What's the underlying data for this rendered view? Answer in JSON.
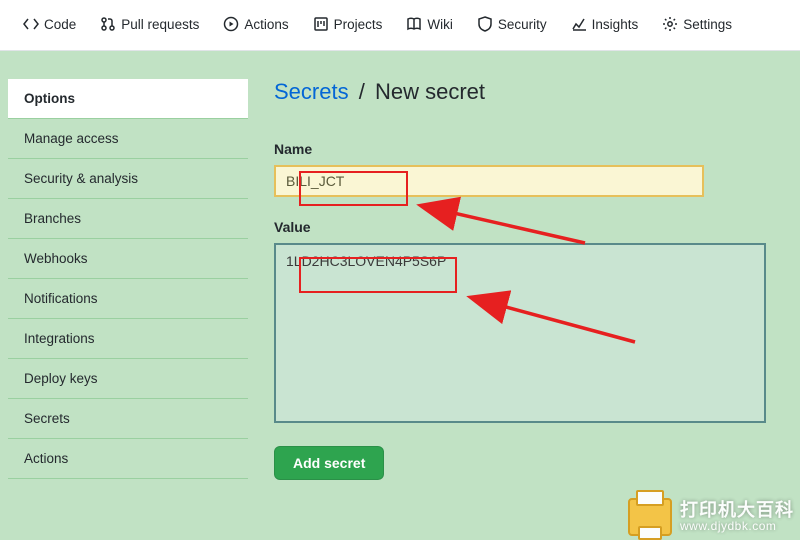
{
  "topnav": {
    "items": [
      {
        "label": "Code"
      },
      {
        "label": "Pull requests"
      },
      {
        "label": "Actions"
      },
      {
        "label": "Projects"
      },
      {
        "label": "Wiki"
      },
      {
        "label": "Security"
      },
      {
        "label": "Insights"
      },
      {
        "label": "Settings"
      }
    ]
  },
  "sidebar": {
    "items": [
      {
        "label": "Options",
        "active": true
      },
      {
        "label": "Manage access"
      },
      {
        "label": "Security & analysis"
      },
      {
        "label": "Branches"
      },
      {
        "label": "Webhooks"
      },
      {
        "label": "Notifications"
      },
      {
        "label": "Integrations"
      },
      {
        "label": "Deploy keys"
      },
      {
        "label": "Secrets"
      },
      {
        "label": "Actions"
      }
    ]
  },
  "breadcrumb": {
    "link": "Secrets",
    "sep": "/",
    "current": "New secret"
  },
  "form": {
    "name_label": "Name",
    "name_value": "BILI_JCT",
    "value_label": "Value",
    "value_value": "1LD2HC3LOVEN4P5S6P",
    "submit_label": "Add secret"
  },
  "watermark": {
    "title": "打印机大百科",
    "url": "www.djydbk.com"
  }
}
